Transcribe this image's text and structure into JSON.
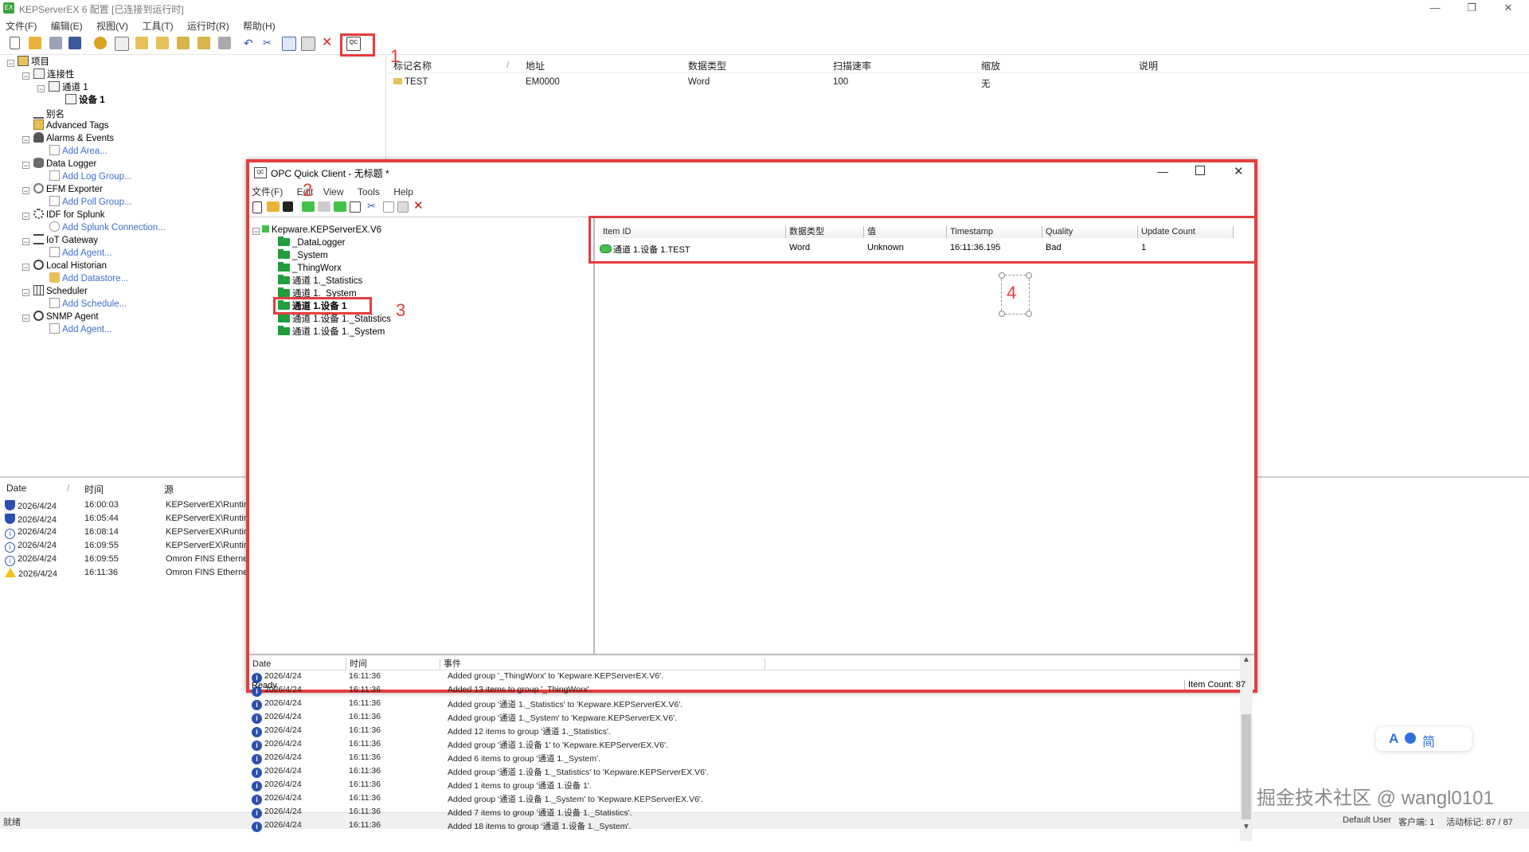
{
  "main_window": {
    "title": "KEPServerEX 6 配置 [已连接到运行时]",
    "menu": [
      "文件(F)",
      "编辑(E)",
      "视图(V)",
      "工具(T)",
      "运行时(R)",
      "帮助(H)"
    ],
    "controls": {
      "minimize": "—",
      "restore": "❐",
      "close": "✕"
    }
  },
  "annotations": [
    "1",
    "2",
    "3",
    "4"
  ],
  "project_tree": {
    "root": "项目",
    "connectivity": "连接性",
    "channel": "通道 1",
    "device": "设备 1",
    "aliases": "别名",
    "items": [
      {
        "label": "Advanced Tags",
        "icon": "advanced-tags-icon"
      },
      {
        "label": "Alarms & Events",
        "icon": "alarms-icon",
        "child": "Add Area..."
      },
      {
        "label": "Data Logger",
        "icon": "data-logger-icon",
        "child": "Add Log Group..."
      },
      {
        "label": "EFM Exporter",
        "icon": "efm-icon",
        "child": "Add Poll Group..."
      },
      {
        "label": "IDF for Splunk",
        "icon": "splunk-icon",
        "child": "Add Splunk Connection..."
      },
      {
        "label": "IoT Gateway",
        "icon": "iot-gateway-icon",
        "child": "Add Agent..."
      },
      {
        "label": "Local Historian",
        "icon": "historian-icon",
        "child": "Add Datastore..."
      },
      {
        "label": "Scheduler",
        "icon": "scheduler-icon",
        "child": "Add Schedule..."
      },
      {
        "label": "SNMP Agent",
        "icon": "snmp-icon",
        "child": "Add Agent..."
      }
    ]
  },
  "tag_table": {
    "headers": [
      "标记名称",
      "地址",
      "数据类型",
      "扫描速率",
      "缩放",
      "说明"
    ],
    "rows": [
      {
        "name": "TEST",
        "address": "EM0000",
        "type": "Word",
        "rate": "100",
        "scaling": "无",
        "desc": ""
      }
    ]
  },
  "event_log": {
    "headers": [
      "Date",
      "时间",
      "源"
    ],
    "rows": [
      {
        "icon": "shield",
        "date": "2026/4/24",
        "time": "16:00:03",
        "source": "KEPServerEX\\Runtim"
      },
      {
        "icon": "shield",
        "date": "2026/4/24",
        "time": "16:05:44",
        "source": "KEPServerEX\\Runtim"
      },
      {
        "icon": "info-outline",
        "date": "2026/4/24",
        "time": "16:08:14",
        "source": "KEPServerEX\\Runtim"
      },
      {
        "icon": "info-outline",
        "date": "2026/4/24",
        "time": "16:09:55",
        "source": "KEPServerEX\\Runtim"
      },
      {
        "icon": "info-outline",
        "date": "2026/4/24",
        "time": "16:09:55",
        "source": "Omron FINS Etherne"
      },
      {
        "icon": "warning",
        "date": "2026/4/24",
        "time": "16:11:36",
        "source": "Omron FINS Etherne"
      }
    ]
  },
  "status_bar": {
    "left": "就绪",
    "user": "Default User",
    "clients": "客户端: 1",
    "active_tags": "活动标记: 87 / 87"
  },
  "opc_client": {
    "title": "OPC Quick Client - 无标题 *",
    "menu": [
      "文件(F)",
      "Edit",
      "View",
      "Tools",
      "Help"
    ],
    "tree": {
      "root": "Kepware.KEPServerEX.V6",
      "groups": [
        "_DataLogger",
        "_System",
        "_ThingWorx",
        "通道 1._Statistics",
        "通道 1._System",
        "通道 1.设备 1",
        "通道 1.设备 1._Statistics",
        "通道 1.设备 1._System"
      ],
      "selected_index": 5
    },
    "items_headers": [
      "Item ID",
      "数据类型",
      "值",
      "Timestamp",
      "Quality",
      "Update Count"
    ],
    "items": [
      {
        "id": "通道 1.设备 1.TEST",
        "type": "Word",
        "value": "Unknown",
        "timestamp": "16:11:36.195",
        "quality": "Bad",
        "count": "1"
      }
    ],
    "log_headers": [
      "Date",
      "时间",
      "事件"
    ],
    "log": [
      {
        "date": "2026/4/24",
        "time": "16:11:36",
        "event": "Added group '_ThingWorx' to 'Kepware.KEPServerEX.V6'."
      },
      {
        "date": "2026/4/24",
        "time": "16:11:36",
        "event": "Added 13 items to group '_ThingWorx'."
      },
      {
        "date": "2026/4/24",
        "time": "16:11:36",
        "event": "Added group '通道 1._Statistics' to 'Kepware.KEPServerEX.V6'."
      },
      {
        "date": "2026/4/24",
        "time": "16:11:36",
        "event": "Added group '通道 1._System' to 'Kepware.KEPServerEX.V6'."
      },
      {
        "date": "2026/4/24",
        "time": "16:11:36",
        "event": "Added 12 items to group '通道 1._Statistics'."
      },
      {
        "date": "2026/4/24",
        "time": "16:11:36",
        "event": "Added group '通道 1.设备 1' to 'Kepware.KEPServerEX.V6'."
      },
      {
        "date": "2026/4/24",
        "time": "16:11:36",
        "event": "Added 6 items to group '通道 1._System'."
      },
      {
        "date": "2026/4/24",
        "time": "16:11:36",
        "event": "Added group '通道 1.设备 1._Statistics' to 'Kepware.KEPServerEX.V6'."
      },
      {
        "date": "2026/4/24",
        "time": "16:11:36",
        "event": "Added 1 items to group '通道 1.设备 1'."
      },
      {
        "date": "2026/4/24",
        "time": "16:11:36",
        "event": "Added group '通道 1.设备 1._System' to 'Kepware.KEPServerEX.V6'."
      },
      {
        "date": "2026/4/24",
        "time": "16:11:36",
        "event": "Added 7 items to group '通道 1.设备 1._Statistics'."
      },
      {
        "date": "2026/4/24",
        "time": "16:11:36",
        "event": "Added 18 items to group '通道 1.设备 1._System'."
      }
    ],
    "status_ready": "Ready",
    "item_count": "Item Count: 87"
  },
  "translate_widget": {
    "label_a": "A",
    "label_zh": "简"
  },
  "watermark": "掘金技术社区 @ wangl0101",
  "colors": {
    "annotation_red": "#e53d3d",
    "link_blue": "#3a6fcf",
    "good_green": "#42c14a"
  }
}
